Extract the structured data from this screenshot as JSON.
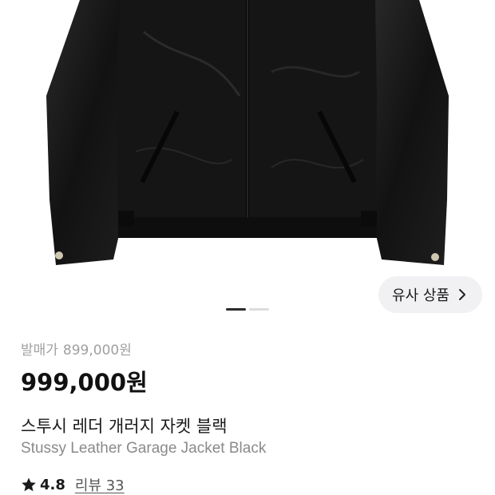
{
  "product": {
    "image_icon": "leather-jacket-image",
    "similar_button_label": "유사 상품",
    "carousel": {
      "total": 2,
      "current": 1
    },
    "retail_label": "발매가",
    "retail_price": "899,000원",
    "price": "999,000원",
    "name_ko": "스투시 레더 개러지 자켓 블랙",
    "name_en": "Stussy Leather Garage Jacket Black",
    "rating": "4.8",
    "reviews_label": "리뷰 33"
  },
  "icons": {
    "star": "star-icon",
    "chevron": "chevron-right-icon"
  },
  "colors": {
    "price": "#111111",
    "retail": "#a0a0a0",
    "button_bg": "#f1f1f3"
  }
}
